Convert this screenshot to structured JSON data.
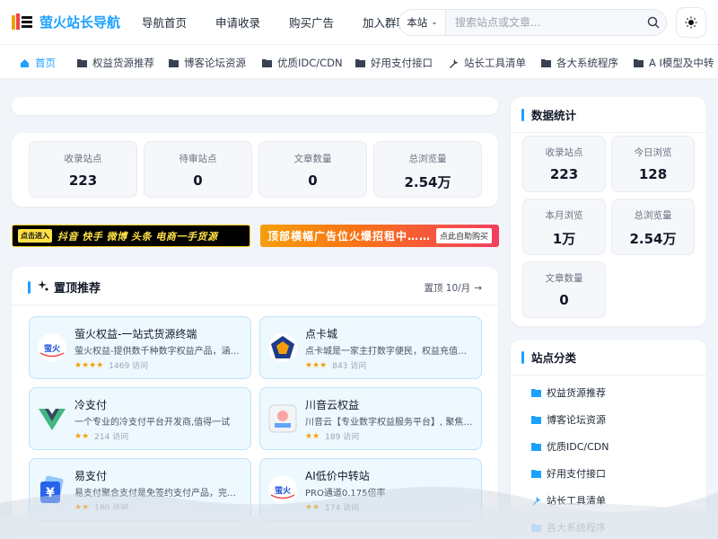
{
  "header": {
    "logo_text": "萤火站长导航",
    "nav": [
      "导航首页",
      "申请收录",
      "购买广告",
      "加入群聊"
    ],
    "search": {
      "scope": "本站",
      "placeholder": "搜索站点或文章..."
    }
  },
  "categories": [
    {
      "label": "首页",
      "icon": "home-icon",
      "active": true
    },
    {
      "label": "权益货源推荐",
      "icon": "folder-icon"
    },
    {
      "label": "博客论坛资源",
      "icon": "folder-icon"
    },
    {
      "label": "优质IDC/CDN",
      "icon": "folder-icon"
    },
    {
      "label": "好用支付接口",
      "icon": "folder-icon"
    },
    {
      "label": "站长工具清单",
      "icon": "wrench-icon"
    },
    {
      "label": "各大系统程序",
      "icon": "folder-icon"
    },
    {
      "label": "A I模型及中转",
      "icon": "folder-icon"
    }
  ],
  "stats": [
    {
      "label": "收录站点",
      "value": "223"
    },
    {
      "label": "待审站点",
      "value": "0"
    },
    {
      "label": "文章数量",
      "value": "0"
    },
    {
      "label": "总浏览量",
      "value": "2.54万"
    }
  ],
  "banners": {
    "left": {
      "tag": "点击进入",
      "text": "抖音 快手 微博 头条 电商一手货源"
    },
    "right": {
      "text": "顶部横幅广告位火爆招租中……",
      "button": "点此自助购买"
    }
  },
  "top": {
    "title": "置顶推荐",
    "meta": "置顶 10/月",
    "sites": [
      {
        "name": "萤火权益-一站式货源终端",
        "desc": "萤火权益-提供数千种数字权益产品，涵盖…",
        "stars": 4,
        "visits": "1469 访问",
        "icon": "yinghuo-logo-icon"
      },
      {
        "name": "点卡城",
        "desc": "点卡城是一家主打数字便民，权益充值，服…",
        "stars": 3,
        "visits": "843 访问",
        "icon": "pentagon-logo-icon"
      },
      {
        "name": "冷支付",
        "desc": "一个专业的冷支付平台开发商,值得一试",
        "stars": 2,
        "visits": "214 访问",
        "icon": "v-logo-icon"
      },
      {
        "name": "川音云权益",
        "desc": "川音云【专业数字权益服务平台】, 聚焦企…",
        "stars": 2,
        "visits": "189 访问",
        "icon": "chuanyin-logo-icon"
      },
      {
        "name": "易支付",
        "desc": "易支付聚合支付是免签约支付产品，完美解…",
        "stars": 2,
        "visits": "180 访问",
        "icon": "yen-wallet-icon"
      },
      {
        "name": "AI低价中转站",
        "desc": "PRO通道0.175倍率",
        "stars": 2,
        "visits": "174 访问",
        "icon": "yinghuo-logo-icon"
      }
    ]
  },
  "sidebar": {
    "stats_title": "数据统计",
    "stats": [
      {
        "label": "收录站点",
        "value": "223"
      },
      {
        "label": "今日浏览",
        "value": "128"
      },
      {
        "label": "本月浏览",
        "value": "1万"
      },
      {
        "label": "总浏览量",
        "value": "2.54万"
      },
      {
        "label": "文章数量",
        "value": "0"
      }
    ],
    "cat_title": "站点分类",
    "cats": [
      {
        "label": "权益货源推荐",
        "icon": "folder-icon"
      },
      {
        "label": "博客论坛资源",
        "icon": "folder-icon"
      },
      {
        "label": "优质IDC/CDN",
        "icon": "folder-icon"
      },
      {
        "label": "好用支付接口",
        "icon": "folder-icon"
      },
      {
        "label": "站长工具清单",
        "icon": "wrench-icon"
      },
      {
        "label": "各大系统程序",
        "icon": "folder-icon"
      }
    ]
  },
  "colors": {
    "accent": "#1da1ff",
    "star": "#f59e0b",
    "card_bg": "#eef8ff"
  }
}
